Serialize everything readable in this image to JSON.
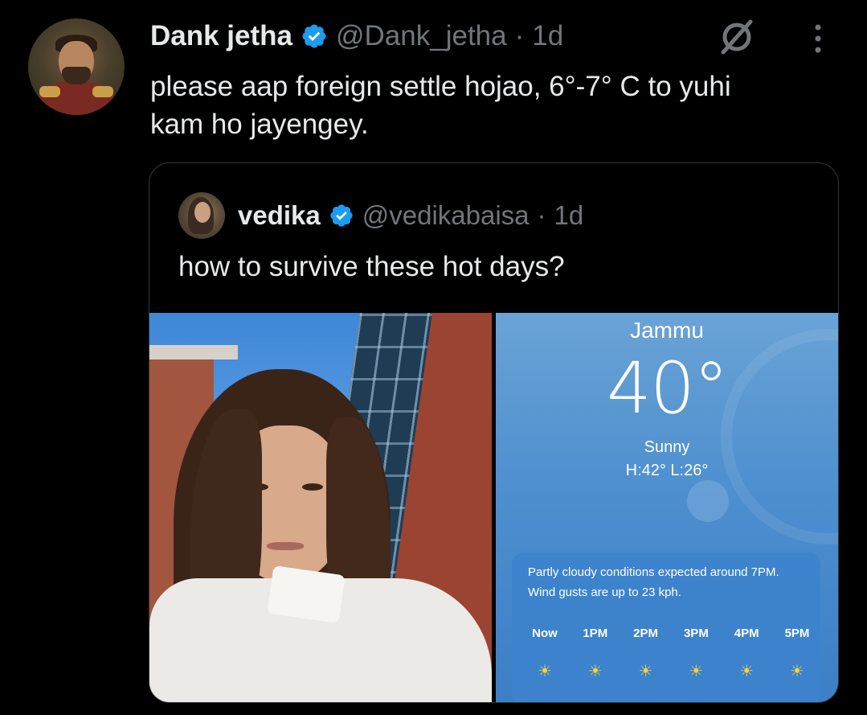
{
  "tweet": {
    "author_name": "Dank jetha",
    "author_handle": "@Dank_jetha",
    "separator": "·",
    "time": "1d",
    "text_line1": "please aap foreign settle hojao, 6°-7° C to yuhi",
    "text_line2": "kam ho jayengey.",
    "icons": {
      "avatar": "avatar-image",
      "verified": "verified-badge-icon",
      "grok": "grok-icon",
      "more": "more-vertical-icon"
    }
  },
  "quote": {
    "author_name": "vedika",
    "author_handle": "@vedikabaisa",
    "separator": "·",
    "time": "1d",
    "text": "how to survive these hot days?"
  },
  "weather": {
    "city": "Jammu",
    "temperature": "40°",
    "condition": "Sunny",
    "high_low": "H:42°  L:26°",
    "summary_line1": "Partly cloudy conditions expected around 7PM.",
    "summary_line2": "Wind gusts are up to 23 kph.",
    "hours": [
      {
        "label": "Now",
        "icon": "☀"
      },
      {
        "label": "1PM",
        "icon": "☀"
      },
      {
        "label": "2PM",
        "icon": "☀"
      },
      {
        "label": "3PM",
        "icon": "☀"
      },
      {
        "label": "4PM",
        "icon": "☀"
      },
      {
        "label": "5PM",
        "icon": "☀"
      }
    ]
  },
  "colors": {
    "background": "#000000",
    "text": "#e7e9ea",
    "muted": "#71767b",
    "verified": "#1d9bf0",
    "border": "#333639"
  }
}
